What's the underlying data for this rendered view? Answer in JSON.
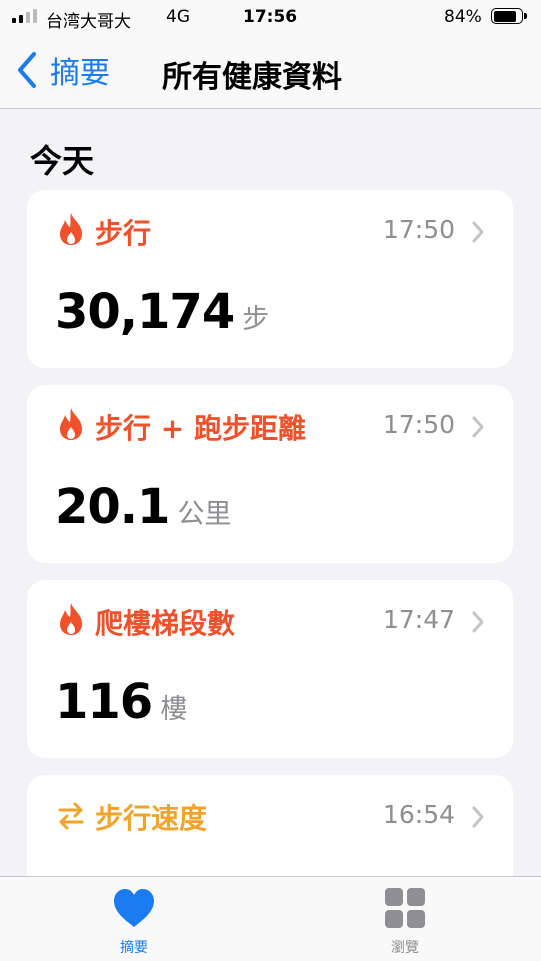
{
  "status_bar": {
    "carrier": "台湾大哥大",
    "network": "4G",
    "time": "17:56",
    "battery_percent": "84%",
    "battery_level": 0.84,
    "signal_bars": 2
  },
  "nav": {
    "back_label": "摘要",
    "title": "所有健康資料"
  },
  "section": {
    "title": "今天"
  },
  "cards": [
    {
      "title": "步行",
      "time": "17:50",
      "value": "30,174",
      "unit": "步",
      "icon": "flame-icon",
      "color": "#f0512a"
    },
    {
      "title": "步行 + 跑步距離",
      "time": "17:50",
      "value": "20.1",
      "unit": "公里",
      "icon": "flame-icon",
      "color": "#f0512a"
    },
    {
      "title": "爬樓梯段數",
      "time": "17:47",
      "value": "116",
      "unit": "樓",
      "icon": "flame-icon",
      "color": "#f0512a"
    },
    {
      "title": "步行速度",
      "time": "16:54",
      "icon": "arrows-swap-icon",
      "color": "#f4a32a"
    }
  ],
  "tab_bar": {
    "summary_label": "摘要",
    "browse_label": "瀏覽",
    "active_color": "#1a7cf0",
    "inactive_color": "#8e8e93"
  }
}
